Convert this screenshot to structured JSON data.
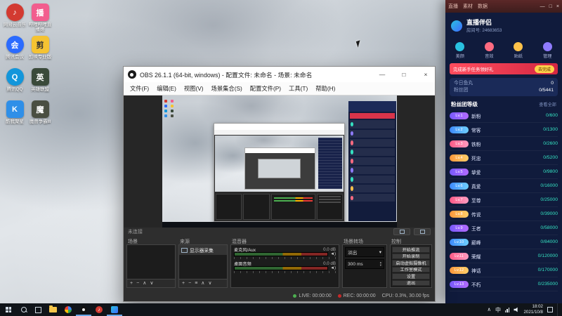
{
  "desktop": {
    "icons": [
      {
        "label": "网易云音乐",
        "glyph": "♪"
      },
      {
        "label": "哔哩哔哩直播姬",
        "glyph": "播"
      },
      {
        "label": "腾讯会议",
        "glyph": "会"
      },
      {
        "label": "剪映专业版",
        "glyph": "剪"
      },
      {
        "label": "腾讯QQ",
        "glyph": "Q"
      },
      {
        "label": "英雄联盟",
        "glyph": "英"
      },
      {
        "label": "酷我聚星",
        "glyph": "K"
      },
      {
        "label": "魔兽争霸Ⅲ",
        "glyph": "魔"
      }
    ]
  },
  "obs": {
    "title": "OBS 26.1.1 (64-bit, windows) - 配置文件: 未命名 - 场景: 未命名",
    "window_controls": {
      "minimize": "—",
      "maximize": "□",
      "close": "×"
    },
    "menus": [
      "文件(F)",
      "编辑(E)",
      "视图(V)",
      "场景集合(S)",
      "配置文件(P)",
      "工具(T)",
      "帮助(H)"
    ],
    "preview_toolbar": {
      "status": "未连接"
    },
    "docks": {
      "scenes": {
        "title": "场景",
        "toolbar": [
          "+",
          "−",
          "∧",
          "∨"
        ]
      },
      "sources": {
        "title": "来源",
        "items": [
          {
            "name": "显示器采集"
          }
        ],
        "toolbar": [
          "+",
          "−",
          "≡",
          "∧",
          "∨"
        ]
      },
      "mixer": {
        "title": "混音器",
        "channels": [
          {
            "name": "麦克风/Aux",
            "db": "0.0 dB",
            "speaker": "◄)"
          },
          {
            "name": "桌面音频",
            "db": "0.0 dB",
            "speaker": "◄)"
          }
        ]
      },
      "transitions": {
        "title": "场景转场",
        "selected": "淡出",
        "caret": "▾",
        "duration": "300 ms",
        "up": "▴",
        "down": "▾"
      },
      "controls": {
        "title": "控制",
        "buttons": [
          "开始推流",
          "开始录制",
          "启动虚拟摄像机",
          "工作室模式",
          "设置",
          "退出"
        ]
      }
    },
    "statusbar": {
      "live": "LIVE: 00:00:00",
      "rec": "REC: 00:00:00",
      "cpu": "CPU: 0.3%, 30.00 fps"
    }
  },
  "companion": {
    "titlebar": {
      "tabs": [
        "直播",
        "素材",
        "数据"
      ],
      "minimize": "—",
      "maximize": "□",
      "close": "×"
    },
    "app_name": "直播伴侣",
    "room_id": "房间号: 24683653",
    "quick_actions": [
      {
        "label": "美颜"
      },
      {
        "label": "音效"
      },
      {
        "label": "贴纸"
      },
      {
        "label": "管理"
      }
    ],
    "banner": {
      "text": "完成新手任务领好礼",
      "button": "去完成"
    },
    "stats": [
      {
        "label": "今日鱼丸",
        "value": "0"
      },
      {
        "label": "粉丝团",
        "value": "0/5441"
      }
    ],
    "list": {
      "title": "粉丝团等级",
      "more": "查看全部",
      "items": [
        {
          "badge": "Lv.1",
          "name": "新粉",
          "value": "0/600"
        },
        {
          "badge": "Lv.2",
          "name": "常客",
          "value": "0/1300"
        },
        {
          "badge": "Lv.3",
          "name": "铁粉",
          "value": "0/2600"
        },
        {
          "badge": "Lv.4",
          "name": "死忠",
          "value": "0/5200"
        },
        {
          "badge": "Lv.5",
          "name": "挚爱",
          "value": "0/9800"
        },
        {
          "badge": "Lv.6",
          "name": "真爱",
          "value": "0/16000"
        },
        {
          "badge": "Lv.7",
          "name": "至尊",
          "value": "0/25000"
        },
        {
          "badge": "Lv.8",
          "name": "传说",
          "value": "0/39000"
        },
        {
          "badge": "Lv.9",
          "name": "王者",
          "value": "0/58000"
        },
        {
          "badge": "Lv.10",
          "name": "巅峰",
          "value": "0/84000"
        },
        {
          "badge": "Lv.11",
          "name": "荣耀",
          "value": "0/120000"
        },
        {
          "badge": "Lv.12",
          "name": "神话",
          "value": "0/170000"
        },
        {
          "badge": "Lv.13",
          "name": "不朽",
          "value": "0/235000"
        }
      ]
    }
  },
  "taskbar": {
    "ime": "中",
    "time": "18:02",
    "date": "2021/10/8"
  }
}
